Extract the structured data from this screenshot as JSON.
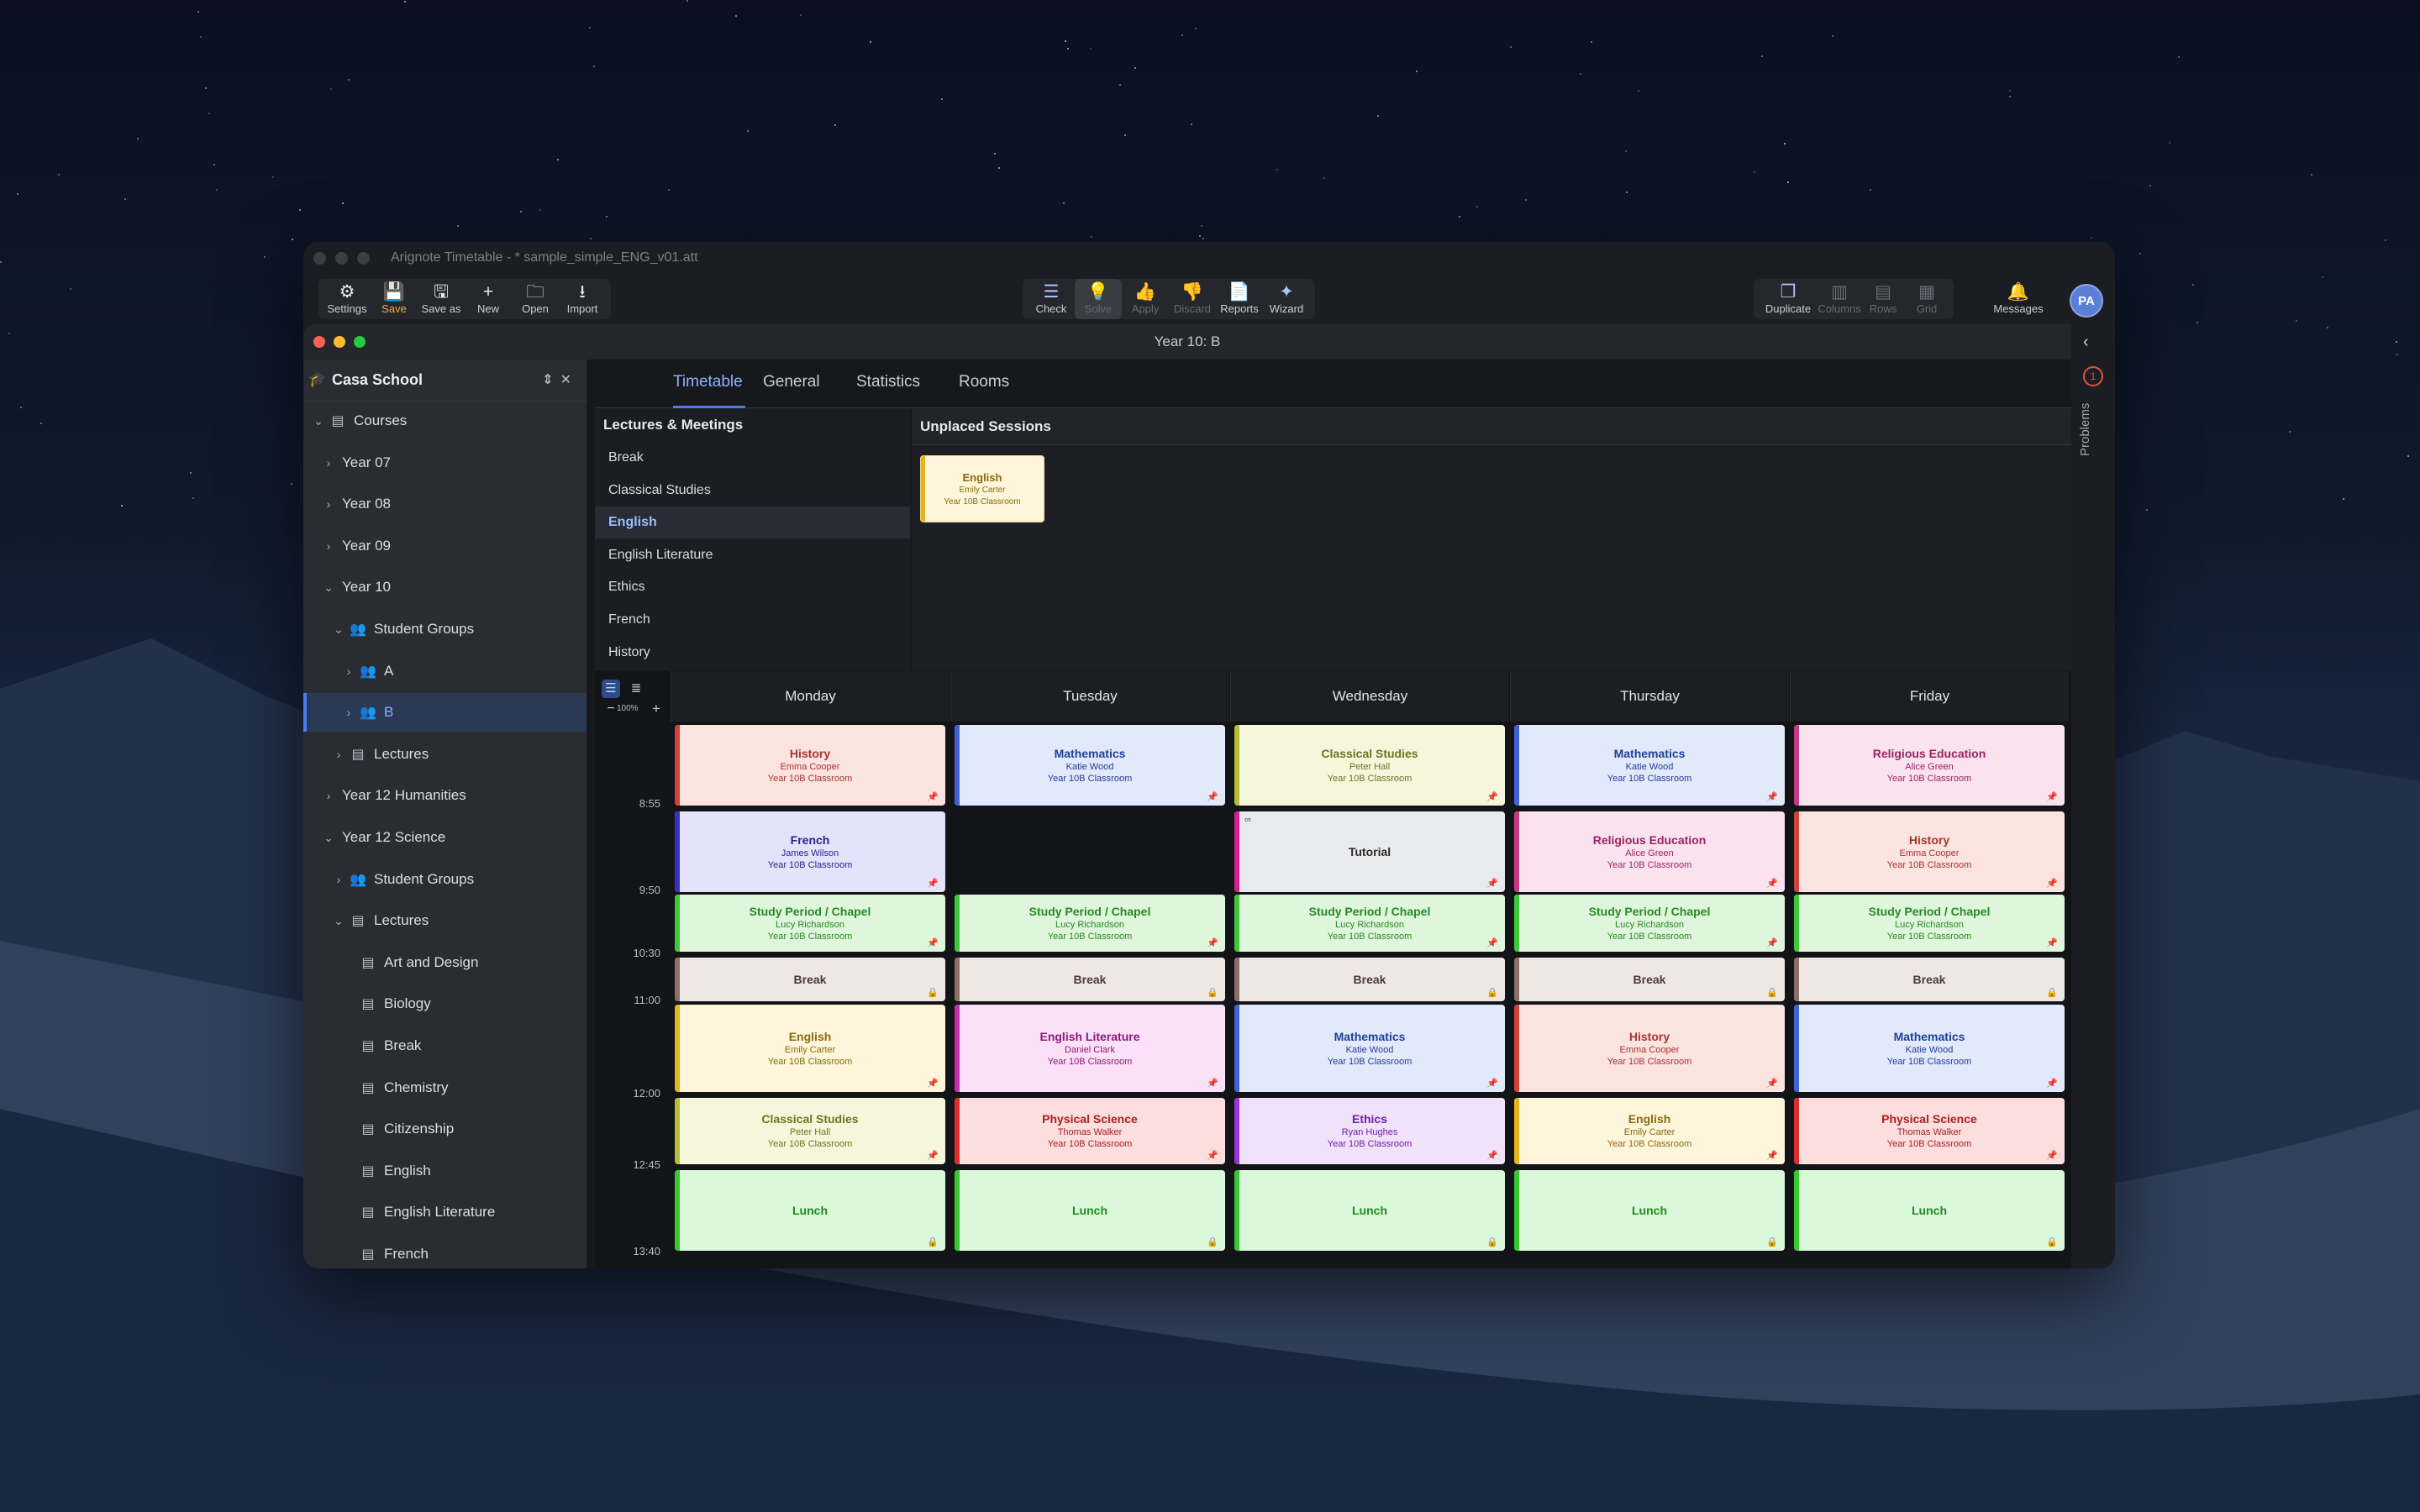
{
  "window": {
    "title": "Arignote Timetable - * sample_simple_ENG_v01.att",
    "inner_title": "Year 10: B"
  },
  "toolbar": {
    "file": [
      {
        "name": "settings-button",
        "icon": "gear-icon",
        "glyph": "⚙",
        "label": "Settings",
        "cls": ""
      },
      {
        "name": "save-button",
        "icon": "save-icon",
        "glyph": "💾",
        "label": "Save",
        "cls": "save"
      },
      {
        "name": "save-as-button",
        "icon": "save-as-icon",
        "glyph": "🖫",
        "label": "Save as",
        "cls": ""
      },
      {
        "name": "new-button",
        "icon": "plus-icon",
        "glyph": "+",
        "label": "New",
        "cls": ""
      },
      {
        "name": "open-button",
        "icon": "folder-icon",
        "glyph": "🗀",
        "label": "Open",
        "cls": ""
      },
      {
        "name": "import-button",
        "icon": "download-icon",
        "glyph": "⭳",
        "label": "Import",
        "cls": ""
      }
    ],
    "solve": [
      {
        "name": "check-button",
        "icon": "check-list-icon",
        "glyph": "☰",
        "label": "Check",
        "cls": "acc"
      },
      {
        "name": "solve-button",
        "icon": "lightbulb-icon",
        "glyph": "💡",
        "label": "Solve",
        "cls": "dis sel"
      },
      {
        "name": "apply-button",
        "icon": "thumbs-up-icon",
        "glyph": "👍",
        "label": "Apply",
        "cls": "dis"
      },
      {
        "name": "discard-button",
        "icon": "thumbs-down-icon",
        "glyph": "👎",
        "label": "Discard",
        "cls": "dis"
      },
      {
        "name": "reports-button",
        "icon": "document-icon",
        "glyph": "📄",
        "label": "Reports",
        "cls": "acc"
      },
      {
        "name": "wizard-button",
        "icon": "magic-wand-icon",
        "glyph": "✦",
        "label": "Wizard",
        "cls": "acc"
      }
    ],
    "view": [
      {
        "name": "duplicate-button",
        "icon": "duplicate-icon",
        "glyph": "❐",
        "label": "Duplicate",
        "cls": "acc"
      },
      {
        "name": "columns-button",
        "icon": "columns-icon",
        "glyph": "▥",
        "label": "Columns",
        "cls": "dis"
      },
      {
        "name": "rows-button",
        "icon": "rows-icon",
        "glyph": "▤",
        "label": "Rows",
        "cls": "dis"
      },
      {
        "name": "grid-button",
        "icon": "grid-icon",
        "glyph": "▦",
        "label": "Grid",
        "cls": "dis"
      }
    ],
    "messages": {
      "name": "messages-button",
      "icon": "bell-icon",
      "glyph": "🔔",
      "label": "Messages",
      "cls": "acc"
    },
    "avatar": "PA"
  },
  "sidebar": {
    "school": "Casa School",
    "tree": [
      {
        "label": "Courses",
        "level": 0,
        "chev": "⌄",
        "icon": "book-icon",
        "glyph": "▤"
      },
      {
        "label": "Year 07",
        "level": 1,
        "chev": "›",
        "icon": "",
        "glyph": ""
      },
      {
        "label": "Year 08",
        "level": 1,
        "chev": "›",
        "icon": "",
        "glyph": ""
      },
      {
        "label": "Year 09",
        "level": 1,
        "chev": "›",
        "icon": "",
        "glyph": ""
      },
      {
        "label": "Year 10",
        "level": 1,
        "chev": "⌄",
        "icon": "",
        "glyph": ""
      },
      {
        "label": "Student Groups",
        "level": 2,
        "chev": "⌄",
        "icon": "people-icon",
        "glyph": "👥"
      },
      {
        "label": "A",
        "level": 3,
        "chev": "›",
        "icon": "people-icon",
        "glyph": "👥"
      },
      {
        "label": "B",
        "level": 3,
        "chev": "›",
        "icon": "people-icon",
        "glyph": "👥",
        "selected": true
      },
      {
        "label": "Lectures",
        "level": 2,
        "chev": "›",
        "icon": "book-icon",
        "glyph": "▤"
      },
      {
        "label": "Year 12 Humanities",
        "level": 1,
        "chev": "›",
        "icon": "",
        "glyph": ""
      },
      {
        "label": "Year 12 Science",
        "level": 1,
        "chev": "⌄",
        "icon": "",
        "glyph": ""
      },
      {
        "label": "Student Groups",
        "level": 2,
        "chev": "›",
        "icon": "people-icon",
        "glyph": "👥"
      },
      {
        "label": "Lectures",
        "level": 2,
        "chev": "⌄",
        "icon": "book-icon",
        "glyph": "▤"
      },
      {
        "label": "Art and Design",
        "level": 3,
        "chev": "",
        "icon": "book-icon",
        "glyph": "▤"
      },
      {
        "label": "Biology",
        "level": 3,
        "chev": "",
        "icon": "book-icon",
        "glyph": "▤"
      },
      {
        "label": "Break",
        "level": 3,
        "chev": "",
        "icon": "book-icon",
        "glyph": "▤"
      },
      {
        "label": "Chemistry",
        "level": 3,
        "chev": "",
        "icon": "book-icon",
        "glyph": "▤"
      },
      {
        "label": "Citizenship",
        "level": 3,
        "chev": "",
        "icon": "book-icon",
        "glyph": "▤"
      },
      {
        "label": "English",
        "level": 3,
        "chev": "",
        "icon": "book-icon",
        "glyph": "▤"
      },
      {
        "label": "English Literature",
        "level": 3,
        "chev": "",
        "icon": "book-icon",
        "glyph": "▤"
      },
      {
        "label": "French",
        "level": 3,
        "chev": "",
        "icon": "book-icon",
        "glyph": "▤"
      }
    ]
  },
  "tabs": [
    "Timetable",
    "General",
    "Statistics",
    "Rooms"
  ],
  "lectures": {
    "title": "Lectures & Meetings",
    "items": [
      "Break",
      "Classical Studies",
      "English",
      "English Literature",
      "Ethics",
      "French",
      "History"
    ],
    "active": 2
  },
  "unplaced": {
    "title": "Unplaced Sessions",
    "card": {
      "title": "English",
      "teacher": "Emily Carter",
      "room": "Year 10B Classroom"
    }
  },
  "grid": {
    "zoom": "100%",
    "days": [
      "Monday",
      "Tuesday",
      "Wednesday",
      "Thursday",
      "Friday"
    ],
    "times": [
      "8:55",
      "9:50",
      "10:30",
      "11:00",
      "12:00",
      "12:45",
      "13:40"
    ]
  },
  "colors": {
    "History": {
      "bg": "#fbe3df",
      "bar": "#d2413a",
      "fg": "#a8342f"
    },
    "Mathematics": {
      "bg": "#e2e9fb",
      "bar": "#4061d8",
      "fg": "#1f3f9a"
    },
    "Classical Studies": {
      "bg": "#f5f6dc",
      "bar": "#b9bb3a",
      "fg": "#6f7420"
    },
    "Religious Education": {
      "bg": "#fbe2ef",
      "bar": "#c43b83",
      "fg": "#9a2463"
    },
    "French": {
      "bg": "#e5e3fb",
      "bar": "#3a2fc7",
      "fg": "#2a2190"
    },
    "Tutorial": {
      "bg": "#e9eaec",
      "bar": "#d81f8f",
      "fg": "#2b2b2b"
    },
    "Study Period / Chapel": {
      "bg": "#dff6dc",
      "bar": "#3fc93a",
      "fg": "#258a22"
    },
    "Break": {
      "bg": "#efe7e4",
      "bar": "#8b6f68",
      "fg": "#4b3b37"
    },
    "English": {
      "bg": "#fdf6da",
      "bar": "#e6b41f",
      "fg": "#8a6a0d"
    },
    "English Literature": {
      "bg": "#fbe0f7",
      "bar": "#c62cb3",
      "fg": "#8c1a7e"
    },
    "Ethics": {
      "bg": "#f1e2fb",
      "bar": "#9a32d8",
      "fg": "#6e1ea8"
    },
    "Physical Science": {
      "bg": "#fbdedd",
      "bar": "#df2c2c",
      "fg": "#a81f1f"
    },
    "Lunch": {
      "bg": "#dcf8da",
      "bar": "#37c82f",
      "fg": "#208a1b"
    }
  },
  "sessions": [
    {
      "day": 0,
      "row": 0,
      "title": "History",
      "teacher": "Emma Cooper",
      "room": "Year 10B Classroom",
      "icon": "pin"
    },
    {
      "day": 1,
      "row": 0,
      "title": "Mathematics",
      "teacher": "Katie Wood",
      "room": "Year 10B Classroom",
      "icon": "pin"
    },
    {
      "day": 2,
      "row": 0,
      "title": "Classical Studies",
      "teacher": "Peter Hall",
      "room": "Year 10B Classroom",
      "icon": "pin"
    },
    {
      "day": 3,
      "row": 0,
      "title": "Mathematics",
      "teacher": "Katie Wood",
      "room": "Year 10B Classroom",
      "icon": "pin"
    },
    {
      "day": 4,
      "row": 0,
      "title": "Religious Education",
      "teacher": "Alice Green",
      "room": "Year 10B Classroom",
      "icon": "pin"
    },
    {
      "day": 0,
      "row": 1,
      "title": "French",
      "teacher": "James Wilson",
      "room": "Year 10B Classroom",
      "icon": "pin"
    },
    {
      "day": 2,
      "row": 1,
      "title": "Tutorial",
      "teacher": "",
      "room": "",
      "icon": "pin",
      "link": true
    },
    {
      "day": 3,
      "row": 1,
      "title": "Religious Education",
      "teacher": "Alice Green",
      "room": "Year 10B Classroom",
      "icon": "pin"
    },
    {
      "day": 4,
      "row": 1,
      "title": "History",
      "teacher": "Emma Cooper",
      "room": "Year 10B Classroom",
      "icon": "pin"
    },
    {
      "day": 0,
      "row": 2,
      "title": "Study Period / Chapel",
      "teacher": "Lucy Richardson",
      "room": "Year 10B Classroom",
      "icon": "pin"
    },
    {
      "day": 1,
      "row": 2,
      "title": "Study Period / Chapel",
      "teacher": "Lucy Richardson",
      "room": "Year 10B Classroom",
      "icon": "pin"
    },
    {
      "day": 2,
      "row": 2,
      "title": "Study Period / Chapel",
      "teacher": "Lucy Richardson",
      "room": "Year 10B Classroom",
      "icon": "pin"
    },
    {
      "day": 3,
      "row": 2,
      "title": "Study Period / Chapel",
      "teacher": "Lucy Richardson",
      "room": "Year 10B Classroom",
      "icon": "pin"
    },
    {
      "day": 4,
      "row": 2,
      "title": "Study Period / Chapel",
      "teacher": "Lucy Richardson",
      "room": "Year 10B Classroom",
      "icon": "pin"
    },
    {
      "day": 0,
      "row": 3,
      "title": "Break",
      "teacher": "",
      "room": "",
      "icon": "lock"
    },
    {
      "day": 1,
      "row": 3,
      "title": "Break",
      "teacher": "",
      "room": "",
      "icon": "lock"
    },
    {
      "day": 2,
      "row": 3,
      "title": "Break",
      "teacher": "",
      "room": "",
      "icon": "lock"
    },
    {
      "day": 3,
      "row": 3,
      "title": "Break",
      "teacher": "",
      "room": "",
      "icon": "lock"
    },
    {
      "day": 4,
      "row": 3,
      "title": "Break",
      "teacher": "",
      "room": "",
      "icon": "lock"
    },
    {
      "day": 0,
      "row": 4,
      "title": "English",
      "teacher": "Emily Carter",
      "room": "Year 10B Classroom",
      "icon": "pin"
    },
    {
      "day": 1,
      "row": 4,
      "title": "English Literature",
      "teacher": "Daniel Clark",
      "room": "Year 10B Classroom",
      "icon": "pin"
    },
    {
      "day": 2,
      "row": 4,
      "title": "Mathematics",
      "teacher": "Katie Wood",
      "room": "Year 10B Classroom",
      "icon": "pin"
    },
    {
      "day": 3,
      "row": 4,
      "title": "History",
      "teacher": "Emma Cooper",
      "room": "Year 10B Classroom",
      "icon": "pin"
    },
    {
      "day": 4,
      "row": 4,
      "title": "Mathematics",
      "teacher": "Katie Wood",
      "room": "Year 10B Classroom",
      "icon": "pin"
    },
    {
      "day": 0,
      "row": 5,
      "title": "Classical Studies",
      "teacher": "Peter Hall",
      "room": "Year 10B Classroom",
      "icon": "pin"
    },
    {
      "day": 1,
      "row": 5,
      "title": "Physical Science",
      "teacher": "Thomas Walker",
      "room": "Year 10B Classroom",
      "icon": "pin"
    },
    {
      "day": 2,
      "row": 5,
      "title": "Ethics",
      "teacher": "Ryan Hughes",
      "room": "Year 10B Classroom",
      "icon": "pin"
    },
    {
      "day": 3,
      "row": 5,
      "title": "English",
      "teacher": "Emily Carter",
      "room": "Year 10B Classroom",
      "icon": "pin"
    },
    {
      "day": 4,
      "row": 5,
      "title": "Physical Science",
      "teacher": "Thomas Walker",
      "room": "Year 10B Classroom",
      "icon": "pin"
    },
    {
      "day": 0,
      "row": 6,
      "title": "Lunch",
      "teacher": "",
      "room": "",
      "icon": "lock"
    },
    {
      "day": 1,
      "row": 6,
      "title": "Lunch",
      "teacher": "",
      "room": "",
      "icon": "lock"
    },
    {
      "day": 2,
      "row": 6,
      "title": "Lunch",
      "teacher": "",
      "room": "",
      "icon": "lock"
    },
    {
      "day": 3,
      "row": 6,
      "title": "Lunch",
      "teacher": "",
      "room": "",
      "icon": "lock"
    },
    {
      "day": 4,
      "row": 6,
      "title": "Lunch",
      "teacher": "",
      "room": "",
      "icon": "lock"
    }
  ],
  "problems": {
    "count": "1",
    "label": "Problems"
  }
}
